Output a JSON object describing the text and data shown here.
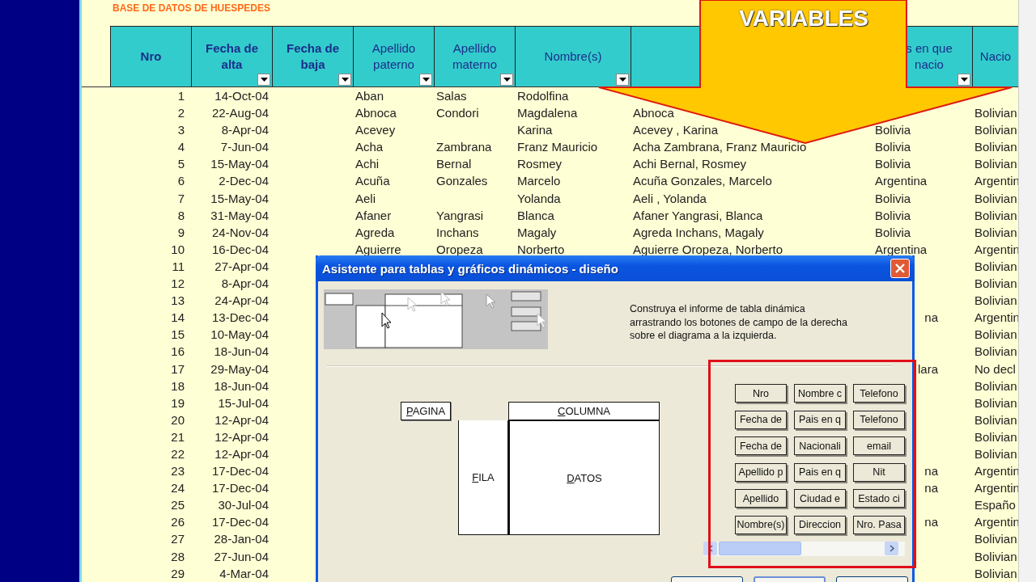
{
  "sheet": {
    "title": "BASE DE DATOS DE HUESPEDES",
    "columns": [
      {
        "label": "Nro",
        "bold": true,
        "filter": false
      },
      {
        "label": "Fecha de alta",
        "bold": true,
        "filter": true
      },
      {
        "label": "Fecha de baja",
        "bold": true,
        "filter": true
      },
      {
        "label": "Apellido paterno",
        "bold": false,
        "filter": true
      },
      {
        "label": "Apellido materno",
        "bold": false,
        "filter": true
      },
      {
        "label": "Nombre(s)",
        "bold": false,
        "filter": true
      },
      {
        "filter": false
      },
      {
        "label": "s en que nacio",
        "bold": false,
        "filter": true
      },
      {
        "label": "Nacio",
        "bold": false,
        "filter": false
      }
    ],
    "rows": [
      {
        "cells": [
          "1",
          "14-Oct-04",
          null,
          "Aban",
          "Salas",
          "Rodolfina",
          null,
          null,
          null
        ]
      },
      {
        "cells": [
          "2",
          "22-Aug-04",
          null,
          "Abnoca",
          "Condori",
          "Magdalena",
          "Abnoca",
          null,
          "Bolivian"
        ]
      },
      {
        "cells": [
          "3",
          "8-Apr-04",
          null,
          "Acevey",
          null,
          "Karina",
          "Acevey , Karina",
          "Bolivia",
          "Bolivian"
        ]
      },
      {
        "cells": [
          "4",
          "7-Jun-04",
          null,
          "Acha",
          "Zambrana",
          "Franz Mauricio",
          "Acha  Zambrana, Franz Mauricio",
          "Bolivia",
          "Bolivian"
        ]
      },
      {
        "cells": [
          "5",
          "15-May-04",
          null,
          "Achi",
          "Bernal",
          "Rosmey",
          "Achi Bernal, Rosmey",
          "Bolivia",
          "Bolivian"
        ]
      },
      {
        "cells": [
          "6",
          "2-Dec-04",
          null,
          "Acuña",
          "Gonzales",
          "Marcelo",
          "Acuña  Gonzales, Marcelo",
          "Argentina",
          "Argentin"
        ]
      },
      {
        "cells": [
          "7",
          "15-May-04",
          null,
          "Aeli",
          null,
          "Yolanda",
          "Aeli , Yolanda",
          "Bolivia",
          "Bolivian"
        ]
      },
      {
        "cells": [
          "8",
          "31-May-04",
          null,
          "Afaner",
          "Yangrasi",
          "Blanca",
          "Afaner Yangrasi, Blanca",
          "Bolivia",
          "Bolivian"
        ]
      },
      {
        "cells": [
          "9",
          "24-Nov-04",
          null,
          "Agreda",
          "Inchans",
          "Magaly",
          "Agreda Inchans, Magaly",
          "Bolivia",
          "Bolivian"
        ]
      },
      {
        "cells": [
          "10",
          "16-Dec-04",
          null,
          "Aguierre",
          "Oropeza",
          "Norberto",
          "Aguierre  Oropeza, Norberto",
          "Argentina",
          "Argentin"
        ]
      },
      {
        "cells": [
          "11",
          "27-Apr-04",
          null,
          null,
          null,
          null,
          null,
          null,
          "Bolivian"
        ]
      },
      {
        "cells": [
          "12",
          "8-Apr-04",
          null,
          null,
          null,
          null,
          null,
          null,
          "Bolivian"
        ]
      },
      {
        "cells": [
          "13",
          "24-Apr-04",
          null,
          null,
          null,
          null,
          null,
          null,
          "Bolivian"
        ]
      },
      {
        "cells": [
          "14",
          "13-Dec-04",
          null,
          null,
          null,
          null,
          null,
          "na",
          "Argentin"
        ]
      },
      {
        "cells": [
          "15",
          "10-May-04",
          null,
          null,
          null,
          null,
          null,
          null,
          "Bolivian"
        ]
      },
      {
        "cells": [
          "16",
          "18-Jun-04",
          null,
          null,
          null,
          null,
          null,
          null,
          "Bolivian"
        ]
      },
      {
        "cells": [
          "17",
          "29-May-04",
          null,
          null,
          null,
          null,
          null,
          "lara",
          "No decl"
        ]
      },
      {
        "cells": [
          "18",
          "18-Jun-04",
          null,
          null,
          null,
          null,
          null,
          null,
          "Bolivian"
        ]
      },
      {
        "cells": [
          "19",
          "15-Jul-04",
          null,
          null,
          null,
          null,
          null,
          null,
          "Bolivian"
        ]
      },
      {
        "cells": [
          "20",
          "12-Apr-04",
          null,
          null,
          null,
          null,
          null,
          null,
          "Bolivian"
        ]
      },
      {
        "cells": [
          "21",
          "12-Apr-04",
          null,
          null,
          null,
          null,
          null,
          null,
          "Bolivian"
        ]
      },
      {
        "cells": [
          "22",
          "12-Apr-04",
          null,
          null,
          null,
          null,
          null,
          null,
          "Bolivian"
        ]
      },
      {
        "cells": [
          "23",
          "17-Dec-04",
          null,
          null,
          null,
          null,
          null,
          "na",
          "Argentin"
        ]
      },
      {
        "cells": [
          "24",
          "17-Dec-04",
          null,
          null,
          null,
          null,
          null,
          "na",
          "Argentin"
        ]
      },
      {
        "cells": [
          "25",
          "30-Jul-04",
          null,
          null,
          null,
          null,
          null,
          null,
          "Españo"
        ]
      },
      {
        "cells": [
          "26",
          "17-Dec-04",
          null,
          null,
          null,
          null,
          null,
          "na",
          "Argentin"
        ]
      },
      {
        "cells": [
          "27",
          "28-Jan-04",
          null,
          null,
          null,
          null,
          null,
          null,
          "Bolivian"
        ]
      },
      {
        "cells": [
          "28",
          "27-Jun-04",
          null,
          null,
          null,
          null,
          null,
          null,
          "Bolivian"
        ]
      },
      {
        "cells": [
          "29",
          "4-Mar-04",
          null,
          null,
          null,
          null,
          null,
          null,
          "Bolivian"
        ]
      }
    ]
  },
  "callout": {
    "label": "VARIABLES"
  },
  "dialog": {
    "title": "Asistente para tablas y gráficos dinámicos - diseño",
    "instructions": "Construya el informe de tabla dinámica arrastrando los botones de campo de la derecha sobre el diagrama a la izquierda.",
    "layout": {
      "page": "PAGINA",
      "column": "COLUMNA",
      "row": "FILA",
      "data": "DATOS"
    },
    "fields": [
      "Nro",
      "Fecha de",
      "Fecha de",
      "Apellido p",
      "Apellido",
      "Nombre(s)",
      "Nombre c",
      "Pais en q",
      "Nacionali",
      "Pais en q",
      "Ciudad e",
      "Direccion",
      "Telefono",
      "Telefono",
      "email",
      "Nit",
      "Estado ci",
      "Nro. Pasa"
    ]
  }
}
